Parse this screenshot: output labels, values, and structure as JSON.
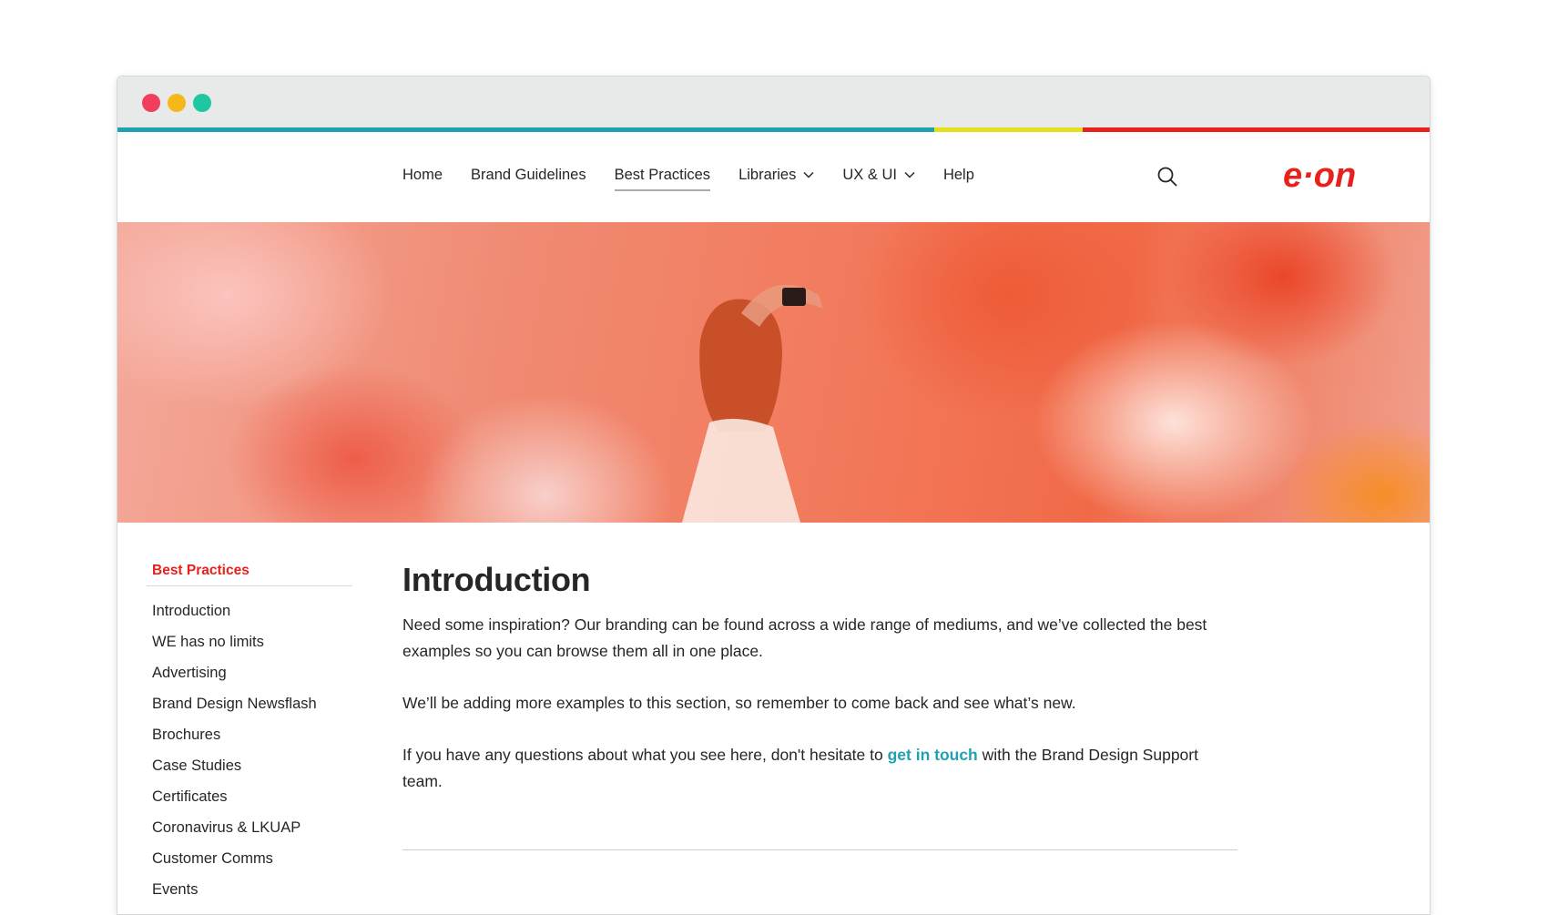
{
  "window": {
    "controls": [
      "close",
      "minimize",
      "maximize"
    ]
  },
  "colors": {
    "accent_red": "#e8211c",
    "accent_teal": "#1ea2b1",
    "accent_yellow": "#e3e01c"
  },
  "nav": {
    "items": [
      {
        "label": "Home"
      },
      {
        "label": "Brand Guidelines"
      },
      {
        "label": "Best Practices"
      },
      {
        "label": "Libraries"
      },
      {
        "label": "UX & UI"
      },
      {
        "label": "Help"
      }
    ],
    "active": "Best Practices",
    "logo_text": "e·on"
  },
  "hero": {
    "icon": "hero-photo"
  },
  "sidebar": {
    "heading": "Best Practices",
    "items": [
      {
        "label": "Introduction"
      },
      {
        "label": "WE has no limits"
      },
      {
        "label": "Advertising"
      },
      {
        "label": "Brand Design Newsflash"
      },
      {
        "label": "Brochures"
      },
      {
        "label": "Case Studies"
      },
      {
        "label": "Certificates"
      },
      {
        "label": "Coronavirus & LKUAP"
      },
      {
        "label": "Customer Comms"
      },
      {
        "label": "Events"
      }
    ]
  },
  "main": {
    "title": "Introduction",
    "paragraphs": {
      "p1": "Need some inspiration? Our branding can be found across a wide range of mediums, and we’ve collected the best examples so you can browse them all in one place.",
      "p2": "We’ll be adding more examples to this section, so remember to come back and see what’s new.",
      "p3_before": "If you have any questions about what you see here, don't hesitate to ",
      "p3_link": "get in touch",
      "p3_after": " with the Brand Design Support team."
    }
  }
}
